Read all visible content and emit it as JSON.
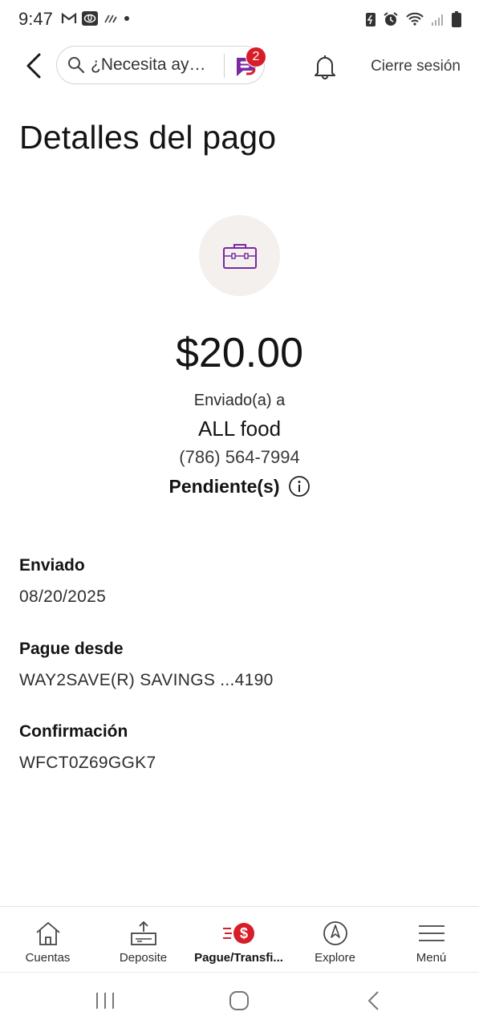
{
  "status_bar": {
    "time": "9:47"
  },
  "header": {
    "search_placeholder": "¿Necesita ay…",
    "badge_count": "2",
    "logout_label": "Cierre sesión"
  },
  "page": {
    "title": "Detalles del pago"
  },
  "payment": {
    "amount": "$20.00",
    "sent_to_label": "Enviado(a) a",
    "recipient_name": "ALL food",
    "recipient_phone": "(786) 564-7994",
    "status": "Pendiente(s)"
  },
  "details": [
    {
      "label": "Enviado",
      "value": "08/20/2025"
    },
    {
      "label": "Pague desde",
      "value": "WAY2SAVE(R) SAVINGS ...4190"
    },
    {
      "label": "Confirmación",
      "value": "WFCT0Z69GGK7"
    }
  ],
  "tab_bar": {
    "tabs": [
      {
        "label": "Cuentas",
        "icon": "home-icon"
      },
      {
        "label": "Deposite",
        "icon": "deposit-icon"
      },
      {
        "label": "Pague/Transfi...",
        "icon": "pay-transfer-icon",
        "active": true
      },
      {
        "label": "Explore",
        "icon": "compass-icon"
      },
      {
        "label": "Menú",
        "icon": "hamburger-icon"
      }
    ]
  },
  "colors": {
    "brand_red": "#d71e28",
    "brand_purple": "#7a2aa0",
    "avatar_bg": "#f4f0ed"
  }
}
